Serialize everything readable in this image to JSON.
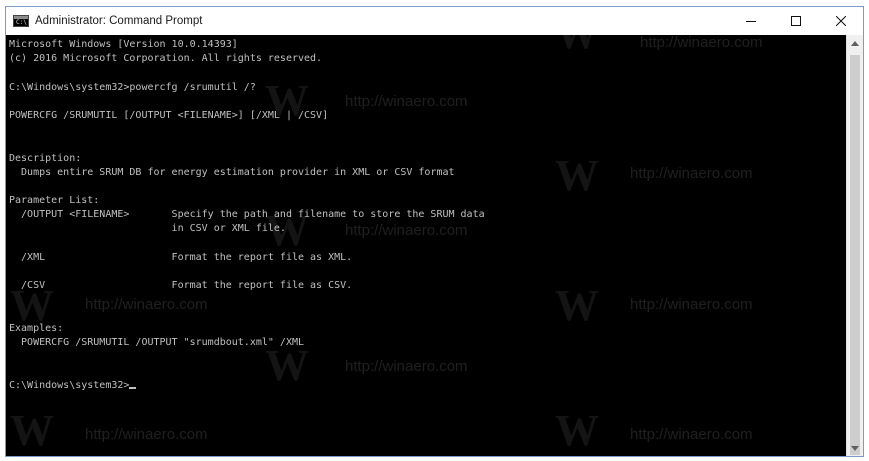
{
  "window": {
    "title": "Administrator: Command Prompt",
    "icon_text": "C:\\",
    "icon": "cmd-icon",
    "controls": {
      "minimize_icon": "minimize-icon",
      "maximize_icon": "maximize-icon",
      "close_icon": "close-icon"
    }
  },
  "console": {
    "lines": [
      "Microsoft Windows [Version 10.0.14393]",
      "(c) 2016 Microsoft Corporation. All rights reserved.",
      "",
      "C:\\Windows\\system32>powercfg /srumutil /?",
      "",
      "POWERCFG /SRUMUTIL [/OUTPUT <FILENAME>] [/XML | /CSV]",
      "",
      "",
      "Description:",
      "  Dumps entire SRUM DB for energy estimation provider in XML or CSV format",
      "",
      "Parameter List:",
      "  /OUTPUT <FILENAME>       Specify the path and filename to store the SRUM data",
      "                           in CSV or XML file.",
      "",
      "  /XML                     Format the report file as XML.",
      "",
      "  /CSV                     Format the report file as CSV.",
      "",
      "",
      "Examples:",
      "  POWERCFG /SRUMUTIL /OUTPUT \"srumdbout.xml\" /XML",
      "",
      "",
      "C:\\Windows\\system32>"
    ]
  },
  "watermark": {
    "text": "http://winaero.com",
    "letter": "W"
  }
}
